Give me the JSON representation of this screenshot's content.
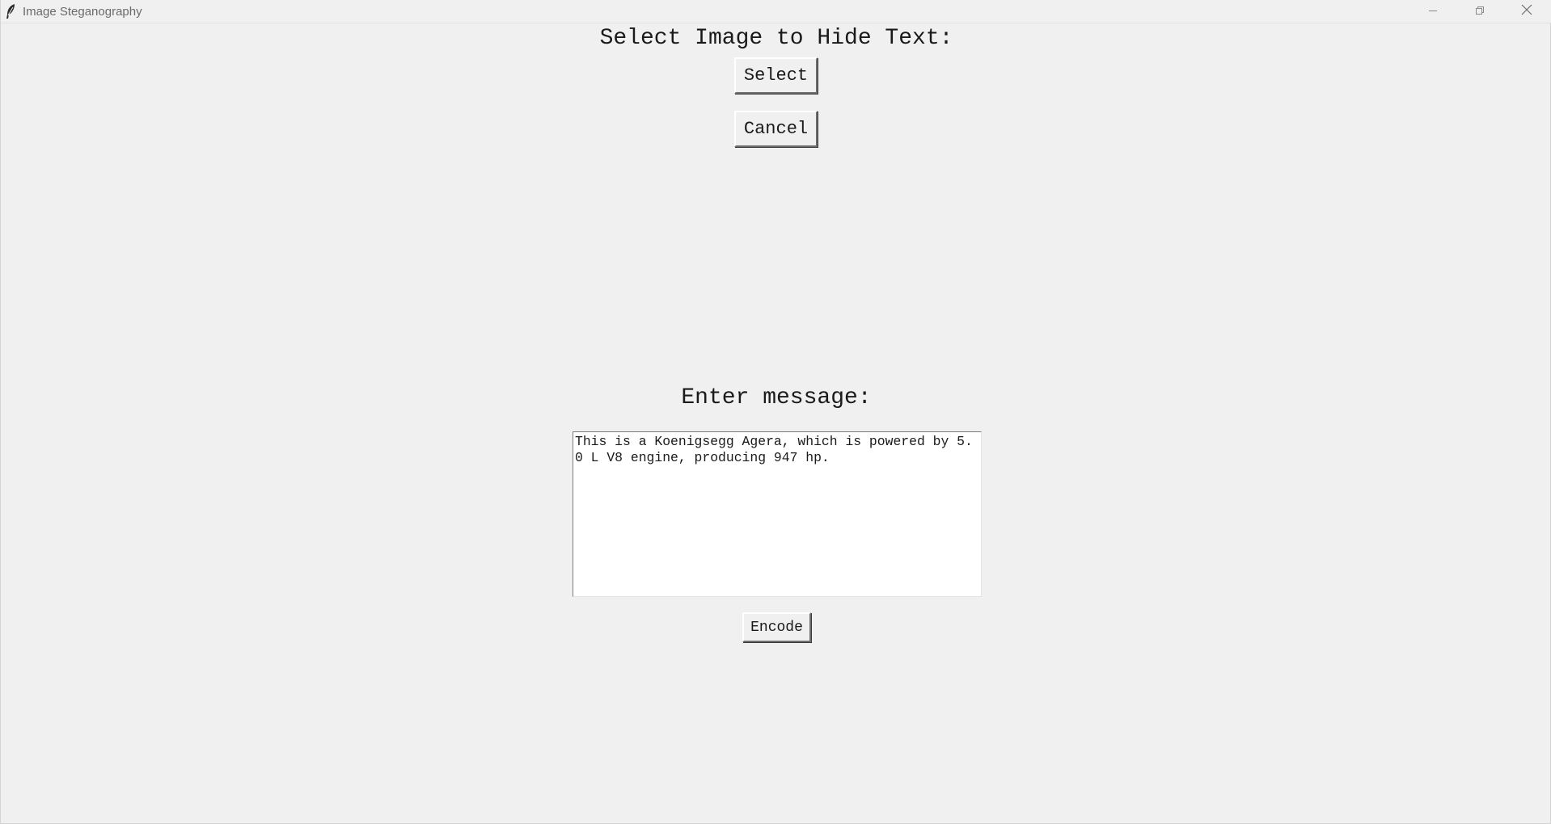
{
  "window": {
    "title": "Image Steganography",
    "app_icon": "feather-icon",
    "controls": {
      "minimize_icon": "minimize-icon",
      "maximize_icon": "restore-icon",
      "close_icon": "close-icon"
    }
  },
  "select_section": {
    "heading": "Select Image to Hide Text:",
    "select_label": "Select",
    "cancel_label": "Cancel"
  },
  "message_section": {
    "heading": "Enter message:",
    "message_text": "This is a Koenigsegg Agera, which is powered by 5.0 L V8 engine, producing 947 hp.",
    "encode_label": "Encode"
  },
  "colors": {
    "window_background": "#f0f0f0",
    "text": "#1a1a1a",
    "input_background": "#ffffff",
    "title_text": "#6b6b6b"
  }
}
